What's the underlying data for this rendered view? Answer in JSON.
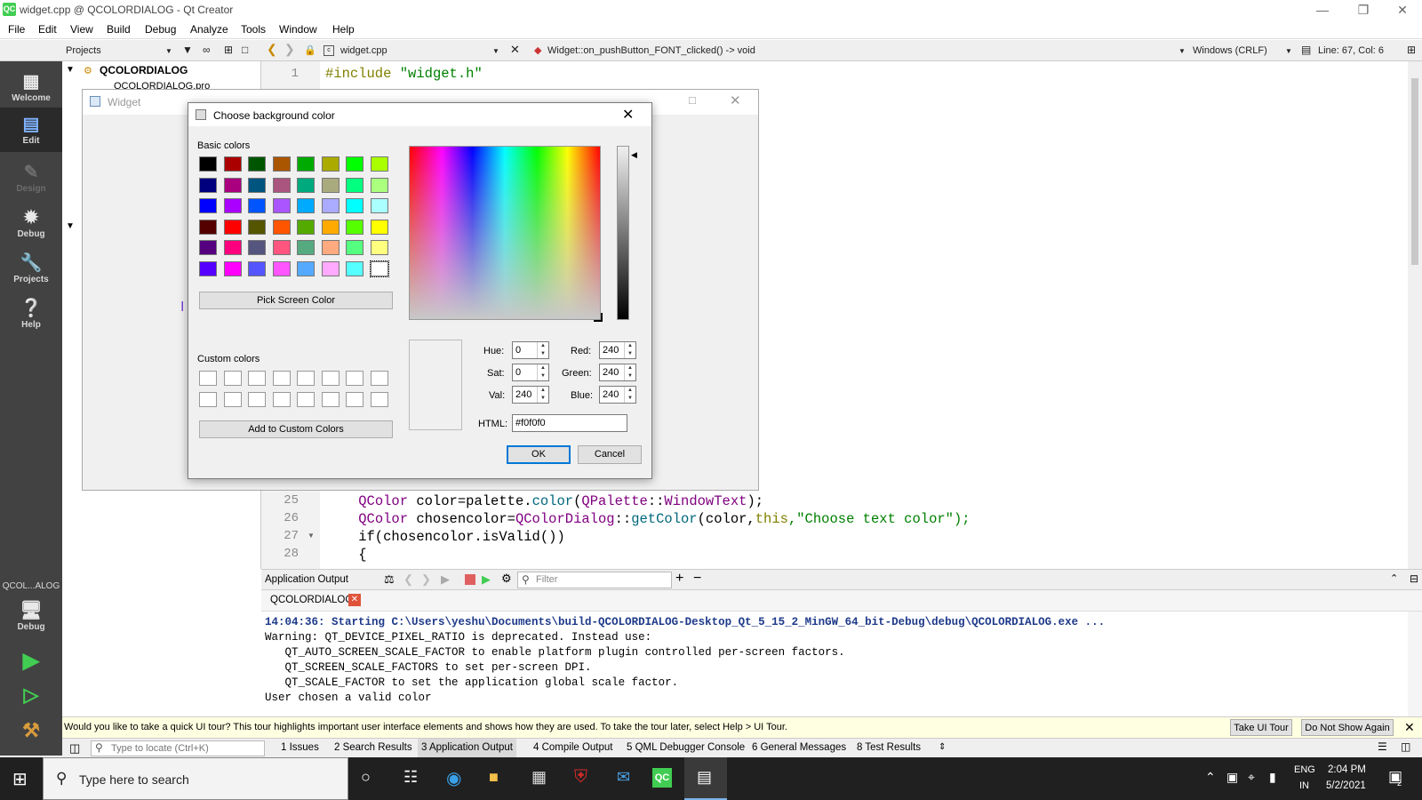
{
  "window": {
    "title": "widget.cpp @ QCOLORDIALOG - Qt Creator",
    "logo": "QC"
  },
  "menu": [
    "File",
    "Edit",
    "View",
    "Build",
    "Debug",
    "Analyze",
    "Tools",
    "Window",
    "Help"
  ],
  "toolbar": {
    "projects_label": "Projects",
    "file_name": "widget.cpp",
    "function_sig": "Widget::on_pushButton_FONT_clicked() -> void",
    "line_ending": "Windows (CRLF)",
    "position": "Line: 67, Col: 6"
  },
  "modes": {
    "welcome": "Welcome",
    "edit": "Edit",
    "design": "Design",
    "debug": "Debug",
    "projects": "Projects",
    "help": "Help",
    "target": "QCOL...ALOG",
    "target_mode": "Debug"
  },
  "project_tree": {
    "root": "QCOLORDIALOG",
    "child": "QCOLORDIALOG.pro"
  },
  "editor": {
    "top_line_number": "1",
    "top_line_directive": "#include",
    "top_line_file": "\"widget.h\"",
    "lines": [
      {
        "n": "25",
        "indent": "    ",
        "a": "QColor",
        "b": " color=palette.",
        "c": "color",
        "d": "(",
        "e": "QPalette",
        "f": "::",
        "g": "WindowText",
        "h": ");"
      },
      {
        "n": "26",
        "indent": "    ",
        "a": "QColor",
        "b": " chosencolor=",
        "c": "QColorDialog",
        "d": "::",
        "e": "getColor",
        "f": "(color,",
        "g": "this",
        "h": ",\"Choose text color\");"
      },
      {
        "n": "27",
        "text": "    if(chosencolor.isValid())"
      },
      {
        "n": "28",
        "text": "    {"
      }
    ]
  },
  "output": {
    "title": "Application Output",
    "filter_placeholder": "Filter",
    "tab": "QCOLORDIALOG",
    "lines": [
      "14:04:36: Starting C:\\Users\\yeshu\\Documents\\build-QCOLORDIALOG-Desktop_Qt_5_15_2_MinGW_64_bit-Debug\\debug\\QCOLORDIALOG.exe ...",
      "Warning: QT_DEVICE_PIXEL_RATIO is deprecated. Instead use:",
      "   QT_AUTO_SCREEN_SCALE_FACTOR to enable platform plugin controlled per-screen factors.",
      "   QT_SCREEN_SCALE_FACTORS to set per-screen DPI.",
      "   QT_SCALE_FACTOR to set the application global scale factor.",
      "User chosen a valid color"
    ]
  },
  "tour": {
    "message": "Would you like to take a quick UI tour? This tour highlights important user interface elements and shows how they are used. To take the tour later, select Help > UI Tour.",
    "take": "Take UI Tour",
    "dismiss": "Do Not Show Again"
  },
  "bottom": {
    "locate_placeholder": "Type to locate (Ctrl+K)",
    "tabs": [
      "1  Issues",
      "2  Search Results",
      "3  Application Output",
      "4  Compile Output",
      "5  QML Debugger Console",
      "6  General Messages",
      "8  Test Results"
    ]
  },
  "widget_window": {
    "title": "Widget"
  },
  "dialog": {
    "title": "Choose background color",
    "basic_label": "Basic colors",
    "basic_colors": [
      "#000000",
      "#aa0000",
      "#005500",
      "#aa5500",
      "#00aa00",
      "#aaaa00",
      "#00ff00",
      "#aaff00",
      "#00007f",
      "#aa007f",
      "#00557f",
      "#aa557f",
      "#00aa7f",
      "#aaaa7f",
      "#00ff7f",
      "#aaff7f",
      "#0000ff",
      "#aa00ff",
      "#0055ff",
      "#aa55ff",
      "#00aaff",
      "#aaaaff",
      "#00ffff",
      "#aaffff",
      "#550000",
      "#ff0000",
      "#555500",
      "#ff5500",
      "#55aa00",
      "#ffaa00",
      "#55ff00",
      "#ffff00",
      "#55007f",
      "#ff007f",
      "#55557f",
      "#ff557f",
      "#55aa7f",
      "#ffaa7f",
      "#55ff7f",
      "#ffff7f",
      "#5500ff",
      "#ff00ff",
      "#5555ff",
      "#ff55ff",
      "#55aaff",
      "#ffaaff",
      "#55ffff",
      "#ffffff"
    ],
    "pick_screen": "Pick Screen Color",
    "custom_label": "Custom colors",
    "add_custom": "Add to Custom Colors",
    "hue_label": "Hue:",
    "hue": "0",
    "sat_label": "Sat:",
    "sat": "0",
    "val_label": "Val:",
    "val": "240",
    "red_label": "Red:",
    "red": "240",
    "green_label": "Green:",
    "green": "240",
    "blue_label": "Blue:",
    "blue": "240",
    "html_label": "HTML:",
    "html": "#f0f0f0",
    "ok": "OK",
    "cancel": "Cancel",
    "current_color": "#f0f0f0"
  },
  "taskbar": {
    "search_placeholder": "Type here to search",
    "lang": "ENG",
    "region": "IN",
    "time": "2:04 PM",
    "date": "5/2/2021",
    "notif_count": "2"
  },
  "colors": {
    "qt_green": "#41cd52",
    "mode_bar": "#424242",
    "taskbar": "#202020",
    "output_blue": "#1e3a8a"
  }
}
